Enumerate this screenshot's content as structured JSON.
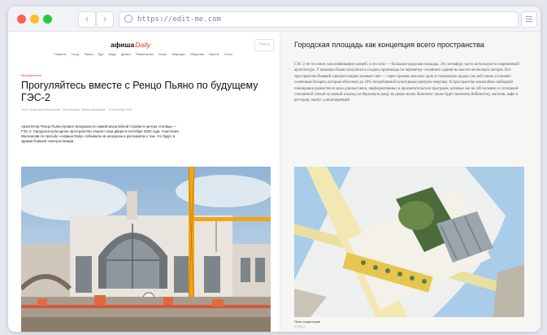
{
  "browser": {
    "url": "https://edit-me.com",
    "back_icon": "‹",
    "forward_icon": "›"
  },
  "site": {
    "logo_main": "афиша",
    "logo_daily": "Daily",
    "search_label": "Поиск",
    "nav": [
      "Новости",
      "Город",
      "Places",
      "Еда",
      "Мода",
      "Деньги",
      "Развлечения",
      "Спорт",
      "Квартиры",
      "Общество",
      "Квесты",
      "Тесты"
    ]
  },
  "article": {
    "rubric": "Мероприятия",
    "headline": "Прогуляйтесь вместе с Ренцо Пьяно по будущему ГЭС-2",
    "meta": "Текст: Анастасия Железнова · Фотографии: Ирина Шварцберг · 18 сентября 2020",
    "lead": "Архитектор Ренцо Пьяно провел экскурсию по самой масштабной стройке в центре столицы — ГЭС-2. Городское культурное пространство откроет свои двери в сентябре 2020 года. Анастасия Железнова по просьбе «Афиши Daily» побывала на экскурсии и рассказала о том, что будет в здании бывшей электростанции."
  },
  "side": {
    "title": "Городская площадь как концепция всего пространства",
    "body": "ГЭС-2 не что иное, как комбинация галерей, а его холл — большая городская площадь. Эту метафору часто используют в современной архитектуре. У команды Пьяно получилось создать променады по периметру основного здания на высоте нескольких метров. Все пространство бывшей электростанции залевает свет — через проемы высоких арок и стеклянную крышу (на ней также установят солнечные батареи, которые обеспечат до 10% потребляемой культурным центром энергии). В пространстве масштабно свободной планировки разместятся залы для выставок, перформативных и просветительских программ, цеховые зал на 420 человек со сплошной стеклянной стеной за сценой и выход на березовую рощу во дворе музея. Комплекс также будет включать библиотеку, магазин, кафе и ресторан, корпус для резиденций.",
    "caption": "План территории",
    "credit": "© ГЭС-2"
  }
}
